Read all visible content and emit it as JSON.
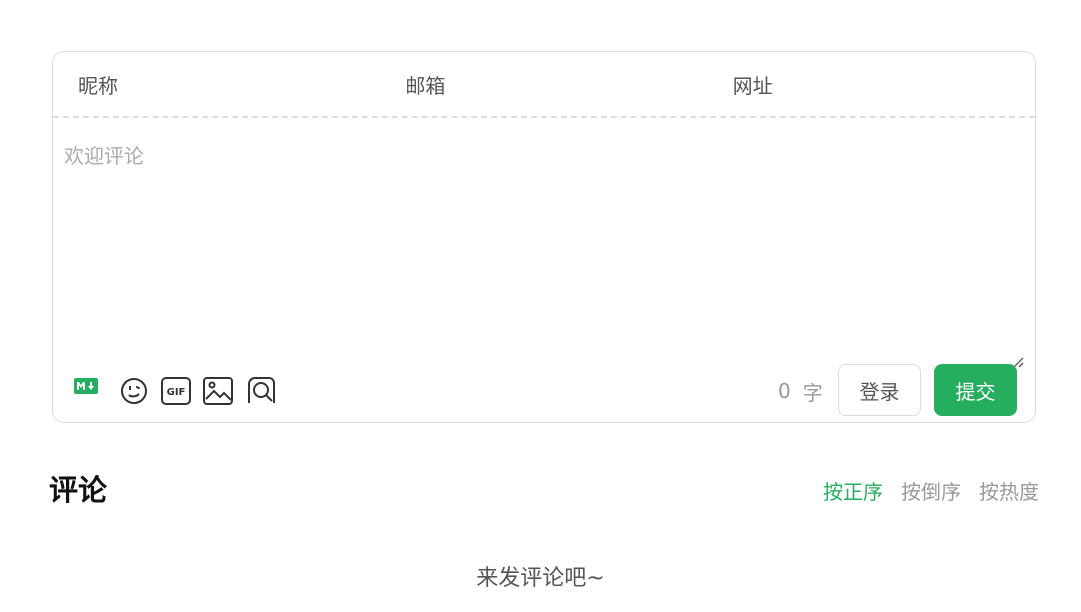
{
  "form": {
    "fields": [
      {
        "label": "昵称"
      },
      {
        "label": "邮箱"
      },
      {
        "label": "网址"
      }
    ],
    "comment_placeholder": "欢迎评论",
    "icons": [
      "markdown-icon",
      "emoji-icon",
      "gif-icon",
      "image-icon",
      "preview-icon"
    ],
    "word_count": "0",
    "word_unit": "字",
    "login_label": "登录",
    "submit_label": "提交",
    "accent_color": "#26ae5f"
  },
  "comments": {
    "title": "评论",
    "sort_options": [
      {
        "label": "按正序",
        "active": true
      },
      {
        "label": "按倒序",
        "active": false
      },
      {
        "label": "按热度",
        "active": false
      }
    ],
    "empty_text": "来发评论吧~"
  }
}
